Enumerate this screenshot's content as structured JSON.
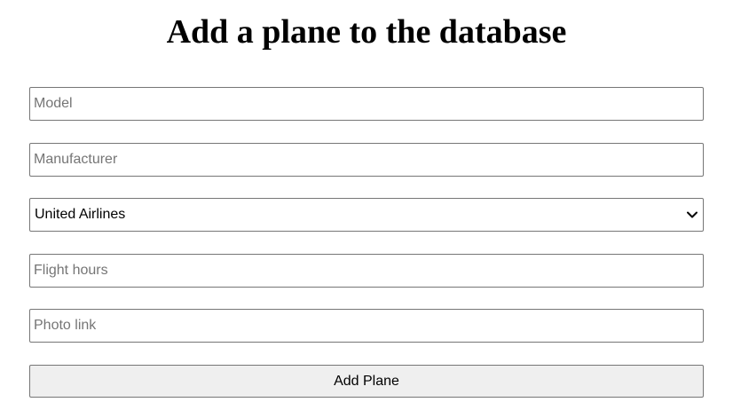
{
  "page": {
    "title": "Add a plane to the database"
  },
  "form": {
    "model": {
      "placeholder": "Model",
      "value": ""
    },
    "manufacturer": {
      "placeholder": "Manufacturer",
      "value": ""
    },
    "airline": {
      "selected": "United Airlines",
      "icon": "chevron-down-icon"
    },
    "flight_hours": {
      "placeholder": "Flight hours",
      "value": ""
    },
    "photo_link": {
      "placeholder": "Photo link",
      "value": ""
    },
    "submit_label": "Add Plane"
  }
}
